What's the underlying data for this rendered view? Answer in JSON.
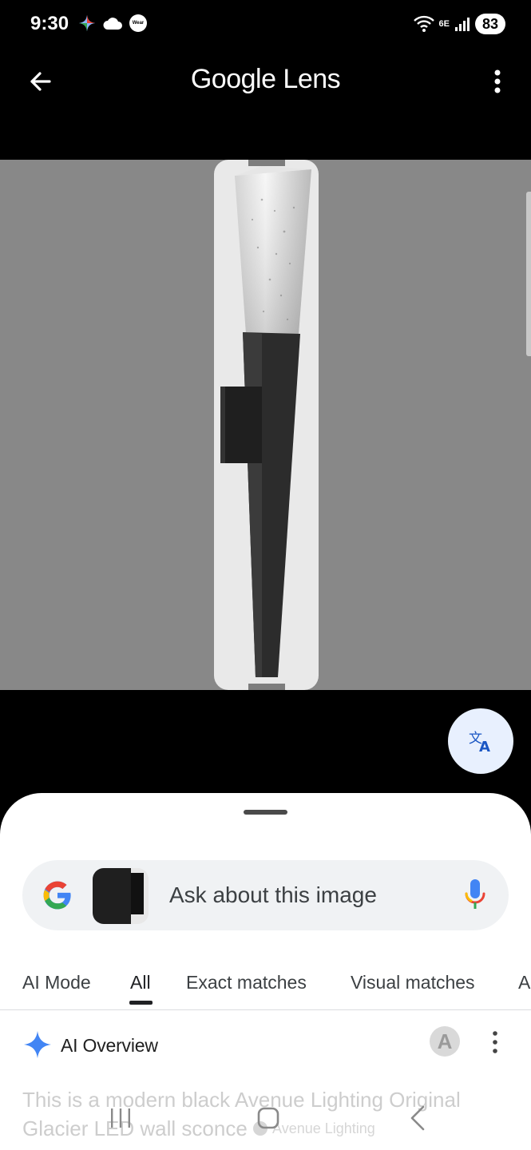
{
  "status_bar": {
    "time": "9:30",
    "wear_label": "Wear",
    "network_label": "6E",
    "battery": "83"
  },
  "app_bar": {
    "title": "Google Lens",
    "back_icon": "arrow-left-icon",
    "menu_icon": "more-vert-icon"
  },
  "viewer": {
    "background_color": "#888888",
    "product_description": "black wall sconce with clear textured top"
  },
  "translate_button": {
    "icon": "translate-icon"
  },
  "search": {
    "placeholder": "Ask about this image"
  },
  "tabs": [
    {
      "label": "AI Mode",
      "active": false
    },
    {
      "label": "All",
      "active": true
    },
    {
      "label": "Exact matches",
      "active": false
    },
    {
      "label": "Visual matches",
      "active": false
    },
    {
      "label": "A",
      "active": false
    }
  ],
  "ai_overview": {
    "title": "AI Overview",
    "source_avatar_letter": "A",
    "text_line1": "This is a modern black Avenue Lighting Original",
    "text_line2": "Glacier LED wall sconce",
    "source_chip": "Avenue Lighting"
  },
  "colors": {
    "accent_blue": "#4285F4",
    "text_primary": "#202124",
    "sheet_background": "#ffffff",
    "pill_background": "#f0f2f4"
  }
}
